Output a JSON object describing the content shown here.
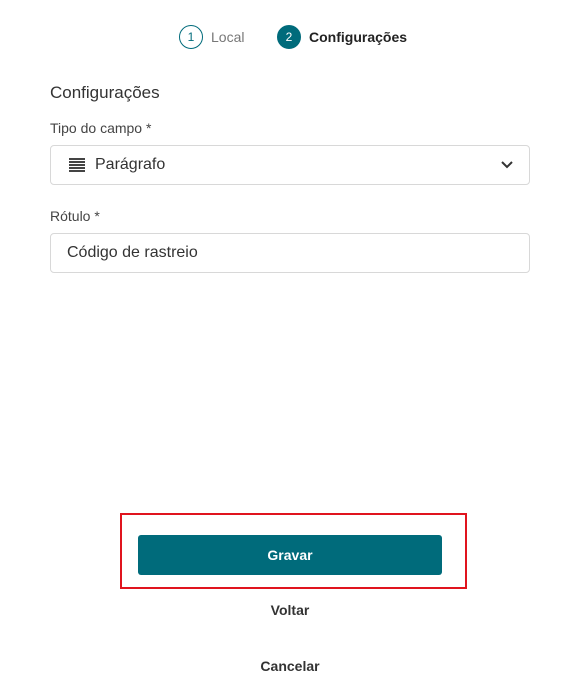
{
  "stepper": {
    "steps": [
      {
        "number": "1",
        "label": "Local",
        "state": "inactive"
      },
      {
        "number": "2",
        "label": "Configurações",
        "state": "active"
      }
    ],
    "accent_color": "#006b7b"
  },
  "form": {
    "section_title": "Configurações",
    "field_type": {
      "label": "Tipo do campo *",
      "icon": "paragraph-lines-icon",
      "value": "Parágrafo"
    },
    "label_field": {
      "label": "Rótulo *",
      "value": "Código de rastreio"
    }
  },
  "actions": {
    "save_label": "Gravar",
    "back_label": "Voltar",
    "cancel_label": "Cancelar",
    "highlight_color": "#e0141e"
  }
}
